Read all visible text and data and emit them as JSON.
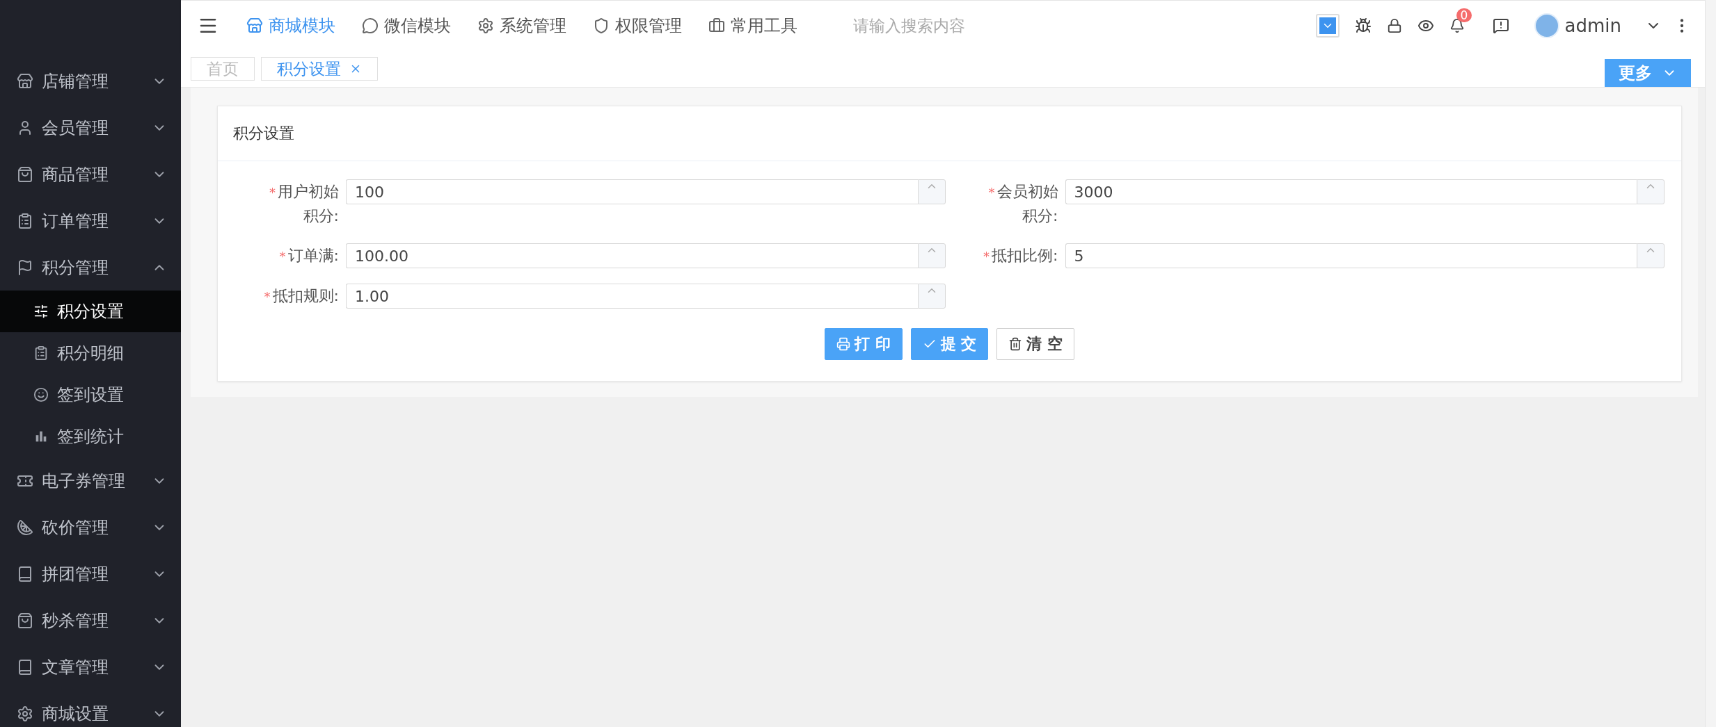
{
  "sidebar": {
    "items": [
      {
        "label": "店铺管理",
        "expanded": false
      },
      {
        "label": "会员管理",
        "expanded": false
      },
      {
        "label": "商品管理",
        "expanded": false
      },
      {
        "label": "订单管理",
        "expanded": false
      },
      {
        "label": "积分管理",
        "expanded": true,
        "children": [
          {
            "label": "积分设置",
            "selected": true
          },
          {
            "label": "积分明细",
            "selected": false
          },
          {
            "label": "签到设置",
            "selected": false
          },
          {
            "label": "签到统计",
            "selected": false
          }
        ]
      },
      {
        "label": "电子券管理",
        "expanded": false
      },
      {
        "label": "砍价管理",
        "expanded": false
      },
      {
        "label": "拼团管理",
        "expanded": false
      },
      {
        "label": "秒杀管理",
        "expanded": false
      },
      {
        "label": "文章管理",
        "expanded": false
      },
      {
        "label": "商城设置",
        "expanded": false
      }
    ]
  },
  "topbar": {
    "modules": [
      {
        "label": "商城模块",
        "selected": true
      },
      {
        "label": "微信模块",
        "selected": false
      },
      {
        "label": "系统管理",
        "selected": false
      },
      {
        "label": "权限管理",
        "selected": false
      },
      {
        "label": "常用工具",
        "selected": false
      }
    ],
    "search": {
      "placeholder": "请输入搜索内容"
    },
    "notification_count": "0",
    "user": "admin"
  },
  "tabs": [
    {
      "label": "首页",
      "selected": false,
      "closable": false
    },
    {
      "label": "积分设置",
      "selected": true,
      "closable": true
    }
  ],
  "more_button": "更多",
  "card": {
    "title": "积分设置",
    "fields": [
      {
        "label": "用户初始积分:",
        "value": "100",
        "required_mark": "*"
      },
      {
        "label": "会员初始积分:",
        "value": "3000",
        "required_mark": "*"
      },
      {
        "label": "订单满:",
        "value": "100.00",
        "required_mark": "*"
      },
      {
        "label": "抵扣比例:",
        "value": "5",
        "required_mark": "*"
      },
      {
        "label": "抵扣规则:",
        "value": "1.00",
        "required_mark": "*"
      }
    ],
    "buttons": [
      {
        "label": "打 印",
        "kind": "print"
      },
      {
        "label": "提 交",
        "kind": "submit"
      },
      {
        "label": "清 空",
        "kind": "clear"
      }
    ]
  }
}
